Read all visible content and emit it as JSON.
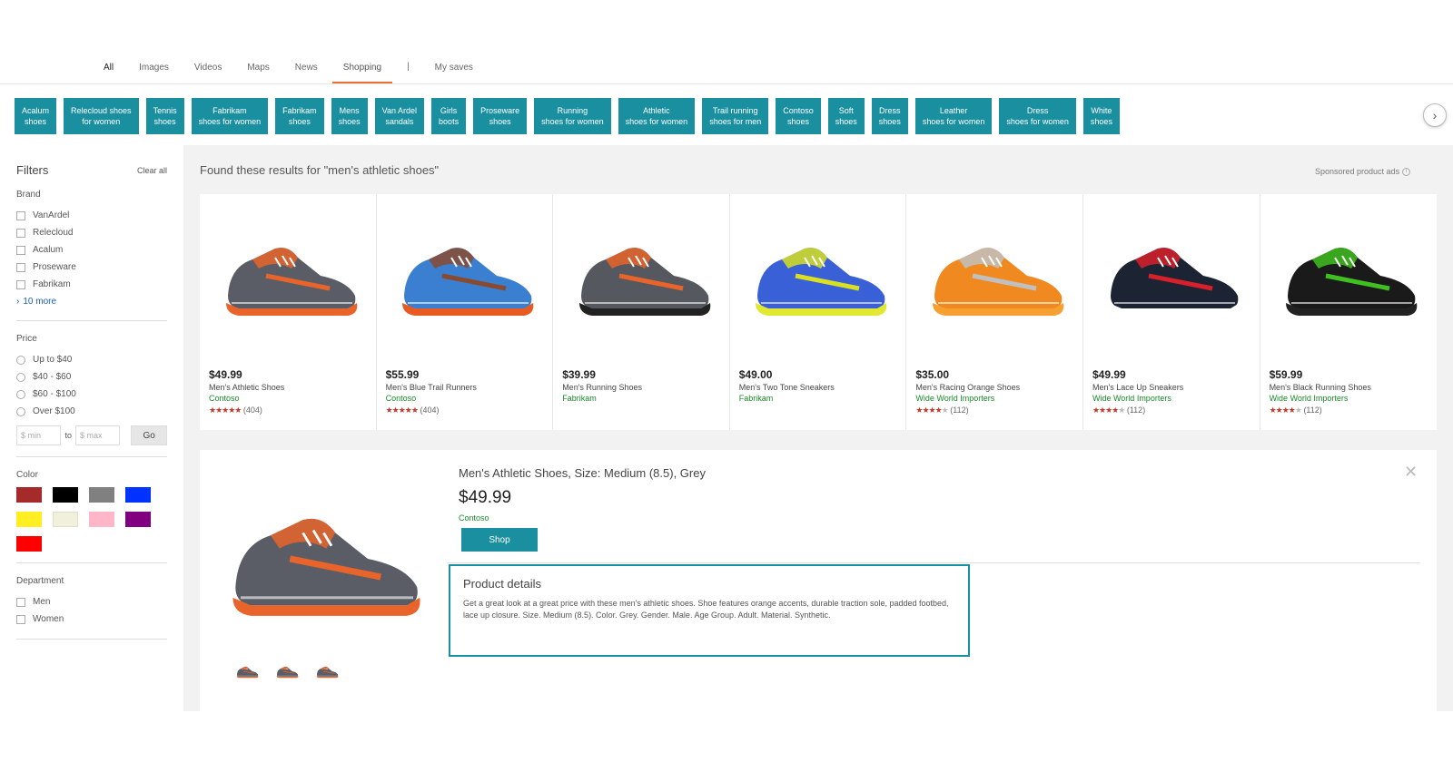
{
  "nav": {
    "tabs": [
      "All",
      "Images",
      "Videos",
      "Maps",
      "News",
      "Shopping"
    ],
    "separator": "|",
    "my_saves": "My saves",
    "active": "Shopping"
  },
  "chips": [
    "Acalum\nshoes",
    "Relecloud shoes\nfor women",
    "Tennis\nshoes",
    "Fabrikam\nshoes for women",
    "Fabrikam\nshoes",
    "Mens\nshoes",
    "Van Ardel\nsandals",
    "Girls\nboots",
    "Proseware\nshoes",
    "Running\nshoes for women",
    "Athletic\nshoes for women",
    "Trail running\nshoes for men",
    "Contoso\nshoes",
    "Soft\nshoes",
    "Dress\nshoes",
    "Leather\nshoes for women",
    "Dress\nshoes for women",
    "White\nshoes"
  ],
  "sidebar": {
    "title": "Filters",
    "clear_all": "Clear all",
    "brand": {
      "title": "Brand",
      "options": [
        "VanArdel",
        "Relecloud",
        "Acalum",
        "Proseware",
        "Fabrikam"
      ],
      "more": "10 more"
    },
    "price": {
      "title": "Price",
      "options": [
        "Up to $40",
        "$40 - $60",
        "$60 - $100",
        "Over $100"
      ],
      "min_placeholder": "$ min",
      "to": "to",
      "max_placeholder": "$ max",
      "go": "Go"
    },
    "color": {
      "title": "Color",
      "swatches": [
        "#a52a2a",
        "#000000",
        "#808080",
        "#0033ff",
        "#ffee22",
        "#f0f0dc",
        "#ffb6c8",
        "#800080",
        "#ff0000"
      ]
    },
    "department": {
      "title": "Department",
      "options": [
        "Men",
        "Women"
      ]
    }
  },
  "results": {
    "heading": "Found these results for \"men's athletic shoes\"",
    "sponsored": "Sponsored product ads"
  },
  "products": [
    {
      "price": "$49.99",
      "name": "Men's Athletic Shoes",
      "merchant": "Contoso",
      "stars": 5,
      "reviews": "(404)",
      "body": "#5a5d66",
      "accent": "#e8642a",
      "sole": "#e8642a"
    },
    {
      "price": "$55.99",
      "name": "Men's Blue Trail Runners",
      "merchant": "Contoso",
      "stars": 5,
      "reviews": "(404)",
      "body": "#3a7fd0",
      "accent": "#8a4a30",
      "sole": "#e85a20"
    },
    {
      "price": "$39.99",
      "name": "Men's Running Shoes",
      "merchant": "Fabrikam",
      "stars": 0,
      "reviews": "",
      "body": "#55585e",
      "accent": "#e8642a",
      "sole": "#222222"
    },
    {
      "price": "$49.00",
      "name": "Men's Two Tone Sneakers",
      "merchant": "Fabrikam",
      "stars": 0,
      "reviews": "",
      "body": "#3a60d8",
      "accent": "#d8e020",
      "sole": "#e0e830"
    },
    {
      "price": "$35.00",
      "name": "Men's Racing Orange Shoes",
      "merchant": "Wide World Importers",
      "stars": 4,
      "reviews": "(112)",
      "body": "#f08a20",
      "accent": "#c0c0c0",
      "sole": "#f5a030"
    },
    {
      "price": "$49.99",
      "name": "Men's Lace Up Sneakers",
      "merchant": "Wide World Importers",
      "stars": 4,
      "reviews": "(112)",
      "body": "#1c2433",
      "accent": "#d8202a",
      "sole": "#ffffff"
    },
    {
      "price": "$59.99",
      "name": "Men's Black Running Shoes",
      "merchant": "Wide World Importers",
      "stars": 4,
      "reviews": "(112)",
      "body": "#1a1a1a",
      "accent": "#40c020",
      "sole": "#222222"
    }
  ],
  "detail": {
    "title": "Men's Athletic Shoes, Size: Medium (8.5), Grey",
    "price": "$49.99",
    "merchant": "Contoso",
    "shop": "Shop",
    "details_title": "Product details",
    "details_text": "Get a great look at a great price with these men's athletic shoes. Shoe features orange accents, durable traction sole, padded footbed, lace up closure. Size. Medium (8.5). Color. Grey. Gender. Male. Age Group. Adult. Material. Synthetic."
  }
}
